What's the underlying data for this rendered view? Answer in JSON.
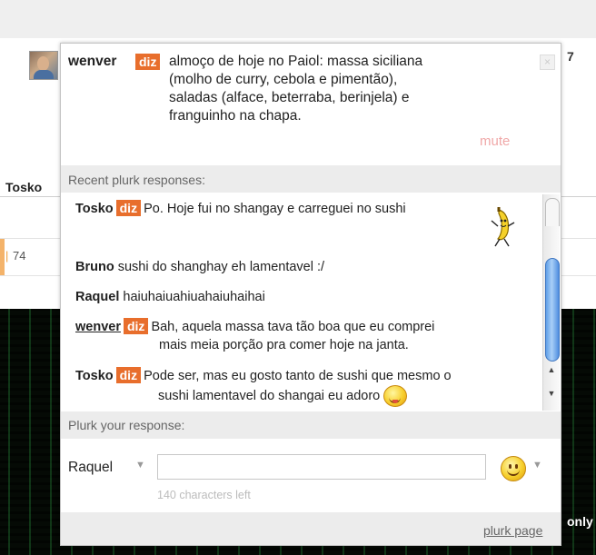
{
  "background": {
    "left_name": "Tosko",
    "count_fragment": "7",
    "bar_text": "74",
    "right_text": "only"
  },
  "plurk": {
    "user": "wenver",
    "qualifier": "diz",
    "text": "almoço de hoje no Paiol: massa siciliana (molho de curry, cebola e pimentão), saladas (alface, beterraba, berinjela) e franguinho na chapa.",
    "mute_label": "mute",
    "close_icon": "×"
  },
  "responses_header": "Recent plurk responses:",
  "responses": [
    {
      "user": "Tosko",
      "qualifier": "diz",
      "text": "Po. Hoje fui no shangay e carreguei no sushi",
      "emoticon": "dancing-banana"
    },
    {
      "user": "Bruno",
      "qualifier": "",
      "text": "sushi do shanghay eh lamentavel :/"
    },
    {
      "user": "Raquel",
      "qualifier": "",
      "text": "haiuhaiuahiuahaiuhaihai"
    },
    {
      "user": "wenver",
      "qualifier": "diz",
      "text": "Bah, aquela massa tava tão boa que eu comprei",
      "text_line2": "mais meia porção pra comer hoje na janta."
    },
    {
      "user": "Tosko",
      "qualifier": "diz",
      "text": "Pode ser, mas eu gosto tanto de sushi que mesmo o",
      "text_line2": "sushi lamentavel do shangai eu adoro",
      "emoticon": "tongue-smile"
    }
  ],
  "compose": {
    "header": "Plurk your response:",
    "user": "Raquel",
    "input_value": "",
    "chars_left": "140 characters left"
  },
  "footer": {
    "link": "plurk page"
  },
  "colors": {
    "qualifier_bg": "#e86e2c",
    "scroll_thumb": "#5f9ee8",
    "band_bg": "#ececec"
  }
}
